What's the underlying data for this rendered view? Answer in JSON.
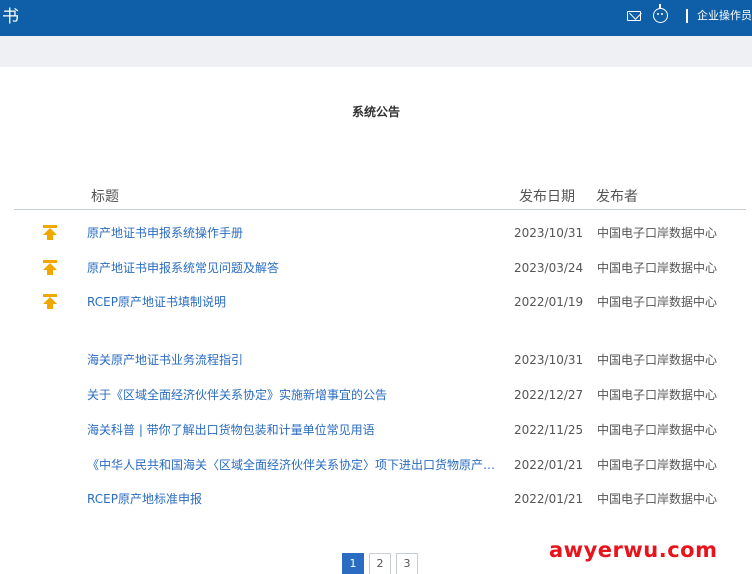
{
  "header": {
    "title_fragment": "书",
    "user_label": "企业操作员"
  },
  "notice": {
    "title": "系统公告",
    "columns": {
      "title": "标题",
      "date": "发布日期",
      "publisher": "发布者"
    },
    "pinned_rows": [
      {
        "title": "原产地证书申报系统操作手册",
        "date": "2023/10/31",
        "publisher": "中国电子口岸数据中心",
        "icon": "pin-top-icon"
      },
      {
        "title": "原产地证书申报系统常见问题及解答",
        "date": "2023/03/24",
        "publisher": "中国电子口岸数据中心",
        "icon": "pin-top-icon"
      },
      {
        "title": "RCEP原产地证书填制说明",
        "date": "2022/01/19",
        "publisher": "中国电子口岸数据中心",
        "icon": "pin-top-icon"
      }
    ],
    "rows": [
      {
        "title": "海关原产地证书业务流程指引",
        "date": "2023/10/31",
        "publisher": "中国电子口岸数据中心"
      },
      {
        "title": "关于《区域全面经济伙伴关系协定》实施新增事宜的公告",
        "date": "2022/12/27",
        "publisher": "中国电子口岸数据中心"
      },
      {
        "title": "海关科普 | 带你了解出口货物包装和计量单位常见用语",
        "date": "2022/11/25",
        "publisher": "中国电子口岸数据中心"
      },
      {
        "title": "《中华人民共和国海关〈区域全面经济伙伴关系协定〉项下进出口货物原产地管理办法》",
        "date": "2022/01/21",
        "publisher": "中国电子口岸数据中心"
      },
      {
        "title": "RCEP原产地标准申报",
        "date": "2022/01/21",
        "publisher": "中国电子口岸数据中心"
      }
    ]
  },
  "pagination": {
    "pages": [
      "1",
      "2",
      "3"
    ],
    "active": "1"
  },
  "watermark": "awyerwu.com",
  "colors": {
    "header_bg": "#0f5fa8",
    "link": "#2a6cc1",
    "pin": "#f0a800",
    "watermark": "#e8141c"
  }
}
